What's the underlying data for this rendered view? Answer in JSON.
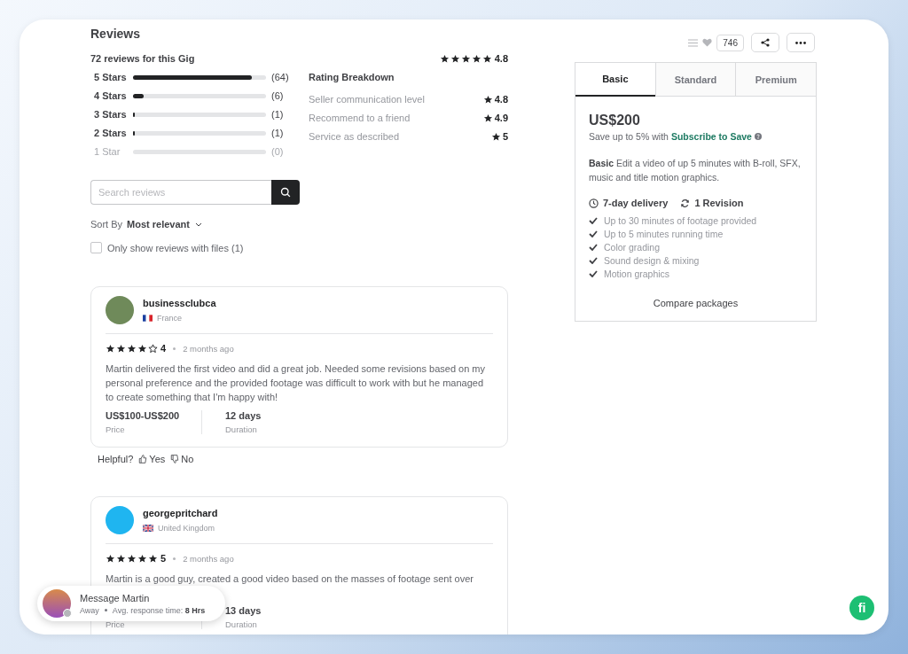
{
  "reviews_header": {
    "title": "Reviews",
    "count_label": "72 reviews for this Gig",
    "stars": 5,
    "rating": "4.8"
  },
  "star_bars": [
    {
      "label": "5 Stars",
      "level": 0.89,
      "count": "(64)",
      "disabled": false
    },
    {
      "label": "4 Stars",
      "level": 0.083,
      "count": "(6)",
      "disabled": false
    },
    {
      "label": "3 Stars",
      "level": 0.014,
      "count": "(1)",
      "disabled": false
    },
    {
      "label": "2 Stars",
      "level": 0.014,
      "count": "(1)",
      "disabled": false
    },
    {
      "label": "1 Star",
      "level": 0,
      "count": "(0)",
      "disabled": true
    }
  ],
  "rating_breakdown": {
    "title": "Rating Breakdown",
    "items": [
      {
        "label": "Seller communication level",
        "value": "4.8"
      },
      {
        "label": "Recommend to a friend",
        "value": "4.9"
      },
      {
        "label": "Service as described",
        "value": "5"
      }
    ]
  },
  "search": {
    "placeholder": "Search reviews"
  },
  "sort": {
    "label": "Sort By",
    "value": "Most relevant"
  },
  "files_filter": {
    "label": "Only show reviews with files (1)",
    "checked": false
  },
  "reviews": [
    {
      "username": "businessclubca",
      "country": "France",
      "kind": "fr",
      "stars": 4,
      "rating": "4",
      "time": "2 months ago",
      "text": "Martin delivered the first video and did a great job. Needed some revisions based on my personal preference and the provided footage was difficult to work with but he managed to create something that I'm happy with!",
      "price": "US$100-US$200",
      "price_label": "Price",
      "duration": "12 days",
      "duration_label": "Duration",
      "helpful": {
        "label": "Helpful?",
        "yes": "Yes",
        "no": "No"
      }
    },
    {
      "username": "georgepritchard",
      "country": "United Kingdom",
      "kind": "gb",
      "stars": 5,
      "rating": "5",
      "time": "2 months ago",
      "text": "Martin is a good guy, created a good video based on the masses of footage sent over",
      "price_label": "Price",
      "duration": "13 days",
      "duration_label": "Duration"
    }
  ],
  "toolbar": {
    "likes": "746"
  },
  "packages": {
    "tabs": [
      {
        "label": "Basic",
        "selected": true
      },
      {
        "label": "Standard",
        "selected": false
      },
      {
        "label": "Premium",
        "selected": false
      }
    ],
    "price": "US$200",
    "save_text": "Save up to 5% with",
    "save_link": "Subscribe to Save",
    "description": "**Basic** Edit a video of up 5 minutes with B-roll, SFX, music and title motion graphics.",
    "delivery": "7-day delivery",
    "revisions": "1 Revision",
    "features": [
      {
        "label": "Up to 30 minutes of footage provided",
        "included": true
      },
      {
        "label": "Up to 5 minutes running time",
        "included": true
      },
      {
        "label": "Color grading",
        "included": true
      },
      {
        "label": "Sound design & mixing",
        "included": true
      },
      {
        "label": "Motion graphics",
        "included": true
      }
    ],
    "compare": "Compare packages"
  },
  "chat": {
    "title": "Message Martin",
    "status": "Away",
    "response_label": "Avg. response time:",
    "response_value": "8 Hrs"
  },
  "logo": {
    "text": "fi"
  }
}
